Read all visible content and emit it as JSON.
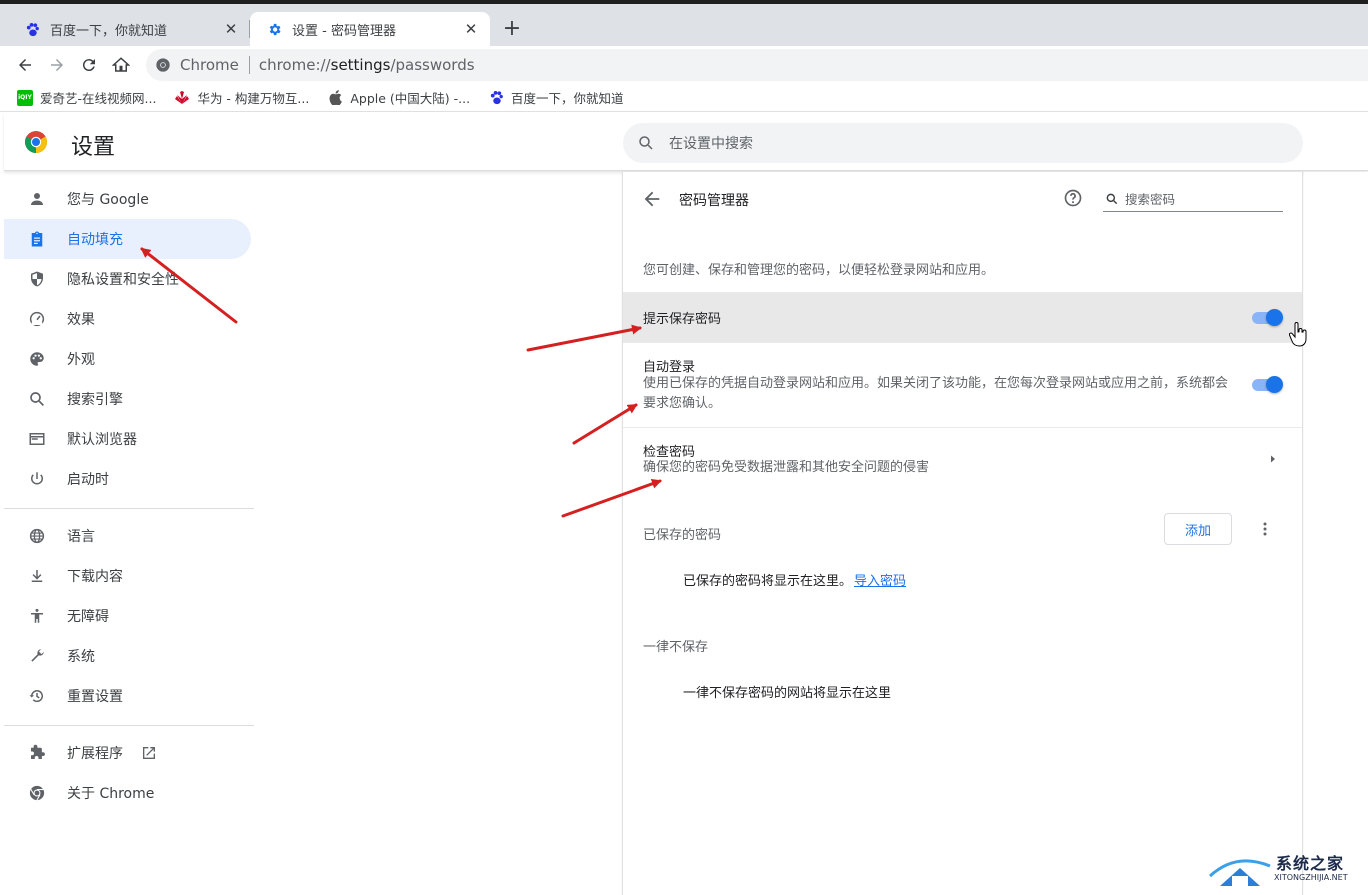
{
  "tabs": [
    {
      "title": "百度一下，你就知道",
      "active": false,
      "icon": "baidu-paw-icon"
    },
    {
      "title": "设置 - 密码管理器",
      "active": true,
      "icon": "gear-icon"
    }
  ],
  "toolbar": {
    "omnibox_chip": "Chrome",
    "url_scheme": "chrome://",
    "url_host": "settings",
    "url_path": "/passwords"
  },
  "bookmarks": [
    {
      "label": "爱奇艺-在线视频网...",
      "icon": "iqiyi-icon"
    },
    {
      "label": "华为 - 构建万物互...",
      "icon": "huawei-icon"
    },
    {
      "label": "Apple (中国大陆) -...",
      "icon": "apple-icon"
    },
    {
      "label": "百度一下，你就知道",
      "icon": "baidu-paw-icon"
    }
  ],
  "header": {
    "title": "设置",
    "search_placeholder": "在设置中搜索"
  },
  "sidebar": {
    "items": [
      {
        "label": "您与 Google",
        "icon": "person-icon",
        "active": false
      },
      {
        "label": "自动填充",
        "icon": "clipboard-icon",
        "active": true
      },
      {
        "label": "隐私设置和安全性",
        "icon": "shield-icon",
        "active": false
      },
      {
        "label": "效果",
        "icon": "speedometer-icon",
        "active": false
      },
      {
        "label": "外观",
        "icon": "palette-icon",
        "active": false
      },
      {
        "label": "搜索引擎",
        "icon": "search-icon",
        "active": false
      },
      {
        "label": "默认浏览器",
        "icon": "browser-icon",
        "active": false
      },
      {
        "label": "启动时",
        "icon": "power-icon",
        "active": false
      },
      {
        "label": "语言",
        "icon": "globe-icon",
        "active": false
      },
      {
        "label": "下载内容",
        "icon": "download-icon",
        "active": false
      },
      {
        "label": "无障碍",
        "icon": "accessibility-icon",
        "active": false
      },
      {
        "label": "系统",
        "icon": "wrench-icon",
        "active": false
      },
      {
        "label": "重置设置",
        "icon": "history-icon",
        "active": false
      },
      {
        "label": "扩展程序",
        "icon": "puzzle-icon",
        "active": false
      },
      {
        "label": "关于 Chrome",
        "icon": "chrome-icon",
        "active": false
      }
    ]
  },
  "password_manager": {
    "title": "密码管理器",
    "search_placeholder": "搜索密码",
    "description": "您可创建、保存和管理您的密码，以便轻松登录网站和应用。",
    "offer_to_save": {
      "label": "提示保存密码",
      "enabled": true
    },
    "auto_signin": {
      "label": "自动登录",
      "sublabel": "使用已保存的凭据自动登录网站和应用。如果关闭了该功能，在您每次登录网站或应用之前，系统都会要求您确认。",
      "enabled": true
    },
    "check_passwords": {
      "label": "检查密码",
      "sublabel": "确保您的密码免受数据泄露和其他安全问题的侵害"
    },
    "saved_passwords_label": "已保存的密码",
    "add_button": "添加",
    "saved_empty_text": "已保存的密码将显示在这里。",
    "import_link": "导入密码",
    "never_saved_label": "一律不保存",
    "never_saved_empty": "一律不保存密码的网站将显示在这里"
  },
  "watermark": {
    "text": "系统之家",
    "sub": "XITONGZHIJIA.NET"
  },
  "colors": {
    "accent": "#1a73e8",
    "active_nav_bg": "#e8f0fe",
    "annotation_arrow": "#d42020",
    "tabstrip": "#dee1e6"
  }
}
